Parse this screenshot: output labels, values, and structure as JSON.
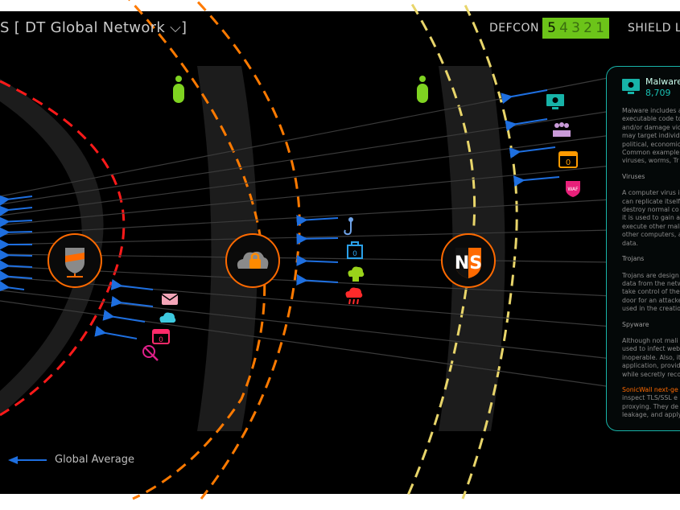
{
  "header": {
    "title": "S [ DT Global Network ⌵]",
    "defcon_label": "DEFCON",
    "defcon_levels": [
      "5",
      "4",
      "3",
      "2",
      "1"
    ],
    "shield_label": "SHIELD LE"
  },
  "legend": {
    "label": "Global Average"
  },
  "panel": {
    "title": "Malware",
    "count": "8,709",
    "paragraphs": [
      "Malware includes a\nexecutable code to\nand/or damage vic\nmay target individ\npolitical, economic\nCommon example\nviruses, worms, Tr"
    ],
    "sections": [
      {
        "heading": "Viruses",
        "text": "A computer virus i\ncan replicate itself\ndestroy normal co\nit is used to gain a\nexecute other mali\nother computers, a\ndata."
      },
      {
        "heading": "Trojans",
        "text": "Trojans are design\ndata from the netw\ntake control of the\ndoor for an attacke\nused in the creatio"
      },
      {
        "heading": "Spyware",
        "text": "Although not mali\nused to infect web\ninoperable. Also, it\napplication, provid\nwhile secretly reco"
      }
    ],
    "highlight": "SonicWall next-ge",
    "footer": "inspect TLS/SSL e\nproxying. They de\nleakage, and apply"
  },
  "colors": {
    "background": "#000000",
    "ring_inner": "#ff1010",
    "ring_middle": "#ff7a00",
    "ring_outer": "#e8d56a",
    "accent_teal": "#17b3a8",
    "defcon_green": "#6cc419",
    "arrow_blue": "#1e6fe0"
  },
  "icons": {
    "ring1_threats": [
      "spam-email-icon",
      "cloud-malware-icon",
      "calendar-zero-day-icon",
      "blocked-search-icon"
    ],
    "ring2_threats": [
      "phishing-hook-icon",
      "ransomware-bag-icon",
      "cloud-bot-icon",
      "cloud-ddos-icon"
    ],
    "ring3_threats": [
      "malware-monitor-icon",
      "botnet-keyboard-icon",
      "zero-day-calendar-icon",
      "waf-shield-icon"
    ],
    "nodes": [
      "firewall-shield-node-icon",
      "cloud-lock-node-icon",
      "ns-shield-node-icon"
    ],
    "status": [
      "user-status-icon",
      "user-status-icon"
    ]
  }
}
